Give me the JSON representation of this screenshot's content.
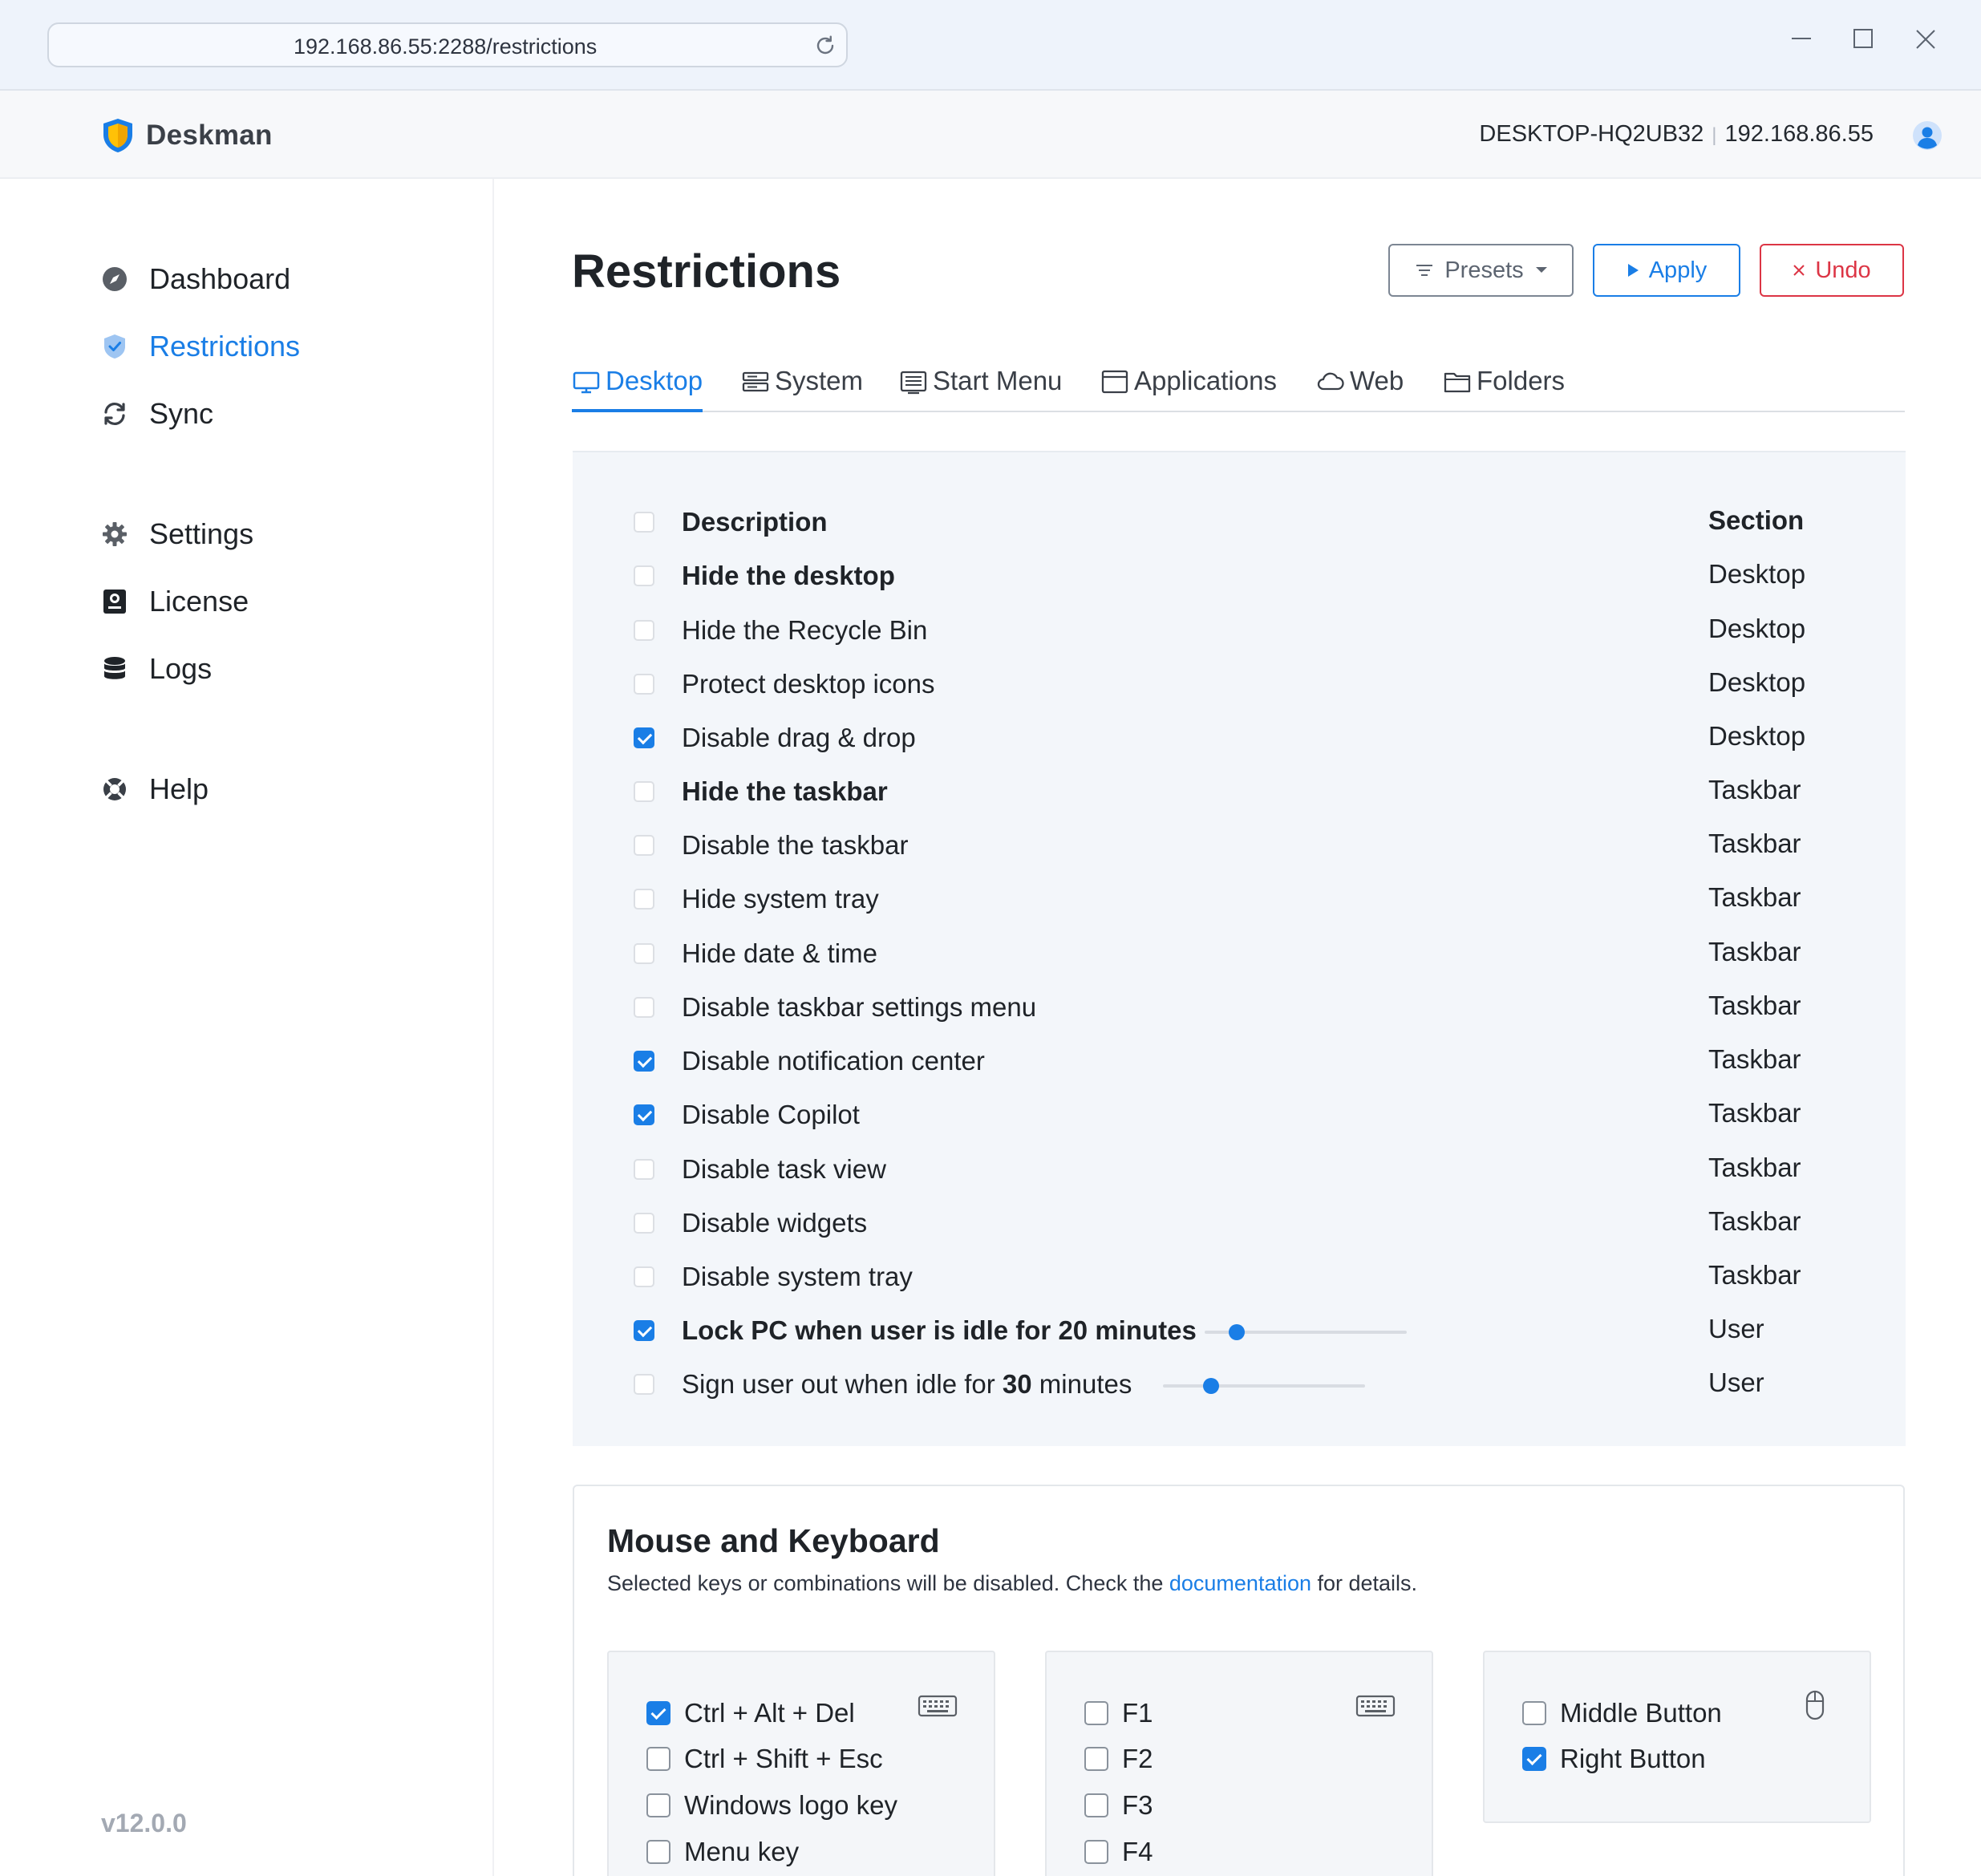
{
  "window": {
    "url": "192.168.86.55:2288/restrictions"
  },
  "header": {
    "brand": "Deskman",
    "machine_name": "DESKTOP-HQ2UB32",
    "ip": "192.168.86.55"
  },
  "sidebar": {
    "items": [
      {
        "label": "Dashboard",
        "icon": "compass-icon"
      },
      {
        "label": "Restrictions",
        "icon": "shield-check-icon",
        "active": true
      },
      {
        "label": "Sync",
        "icon": "sync-icon"
      },
      {
        "label": "Settings",
        "icon": "gear-icon"
      },
      {
        "label": "License",
        "icon": "license-icon"
      },
      {
        "label": "Logs",
        "icon": "database-icon"
      },
      {
        "label": "Help",
        "icon": "lifebuoy-icon"
      }
    ],
    "version": "v12.0.0"
  },
  "main": {
    "title": "Restrictions",
    "buttons": {
      "presets": "Presets",
      "apply": "Apply",
      "undo": "Undo"
    },
    "tabs": [
      {
        "label": "Desktop",
        "icon": "monitor-icon",
        "active": true
      },
      {
        "label": "System",
        "icon": "server-icon"
      },
      {
        "label": "Start Menu",
        "icon": "menu-window-icon"
      },
      {
        "label": "Applications",
        "icon": "app-window-icon"
      },
      {
        "label": "Web",
        "icon": "cloud-icon"
      },
      {
        "label": "Folders",
        "icon": "folder-icon"
      }
    ],
    "table": {
      "headers": {
        "description": "Description",
        "section": "Section"
      },
      "rows": [
        {
          "description": "Hide the desktop",
          "section": "Desktop",
          "checked": false,
          "bold": true
        },
        {
          "description": "Hide the Recycle Bin",
          "section": "Desktop",
          "checked": false
        },
        {
          "description": "Protect desktop icons",
          "section": "Desktop",
          "checked": false
        },
        {
          "description": "Disable drag & drop",
          "section": "Desktop",
          "checked": true
        },
        {
          "description": "Hide the taskbar",
          "section": "Taskbar",
          "checked": false,
          "bold": true
        },
        {
          "description": "Disable the taskbar",
          "section": "Taskbar",
          "checked": false
        },
        {
          "description": "Hide system tray",
          "section": "Taskbar",
          "checked": false
        },
        {
          "description": "Hide date & time",
          "section": "Taskbar",
          "checked": false
        },
        {
          "description": "Disable taskbar settings menu",
          "section": "Taskbar",
          "checked": false
        },
        {
          "description": "Disable notification center",
          "section": "Taskbar",
          "checked": true
        },
        {
          "description": "Disable Copilot",
          "section": "Taskbar",
          "checked": true
        },
        {
          "description": "Disable task view",
          "section": "Taskbar",
          "checked": false
        },
        {
          "description": "Disable widgets",
          "section": "Taskbar",
          "checked": false
        },
        {
          "description": "Disable system tray",
          "section": "Taskbar",
          "checked": false
        },
        {
          "description_pre": "Lock PC when user is idle for ",
          "minutes": "20",
          "description_post": " minutes",
          "section": "User",
          "checked": true,
          "bold": true,
          "slider_level": 0.16
        },
        {
          "description_pre": "Sign user out when idle for ",
          "minutes": "30",
          "description_post": " minutes",
          "section": "User",
          "checked": false,
          "slider_level": 0.24
        }
      ]
    },
    "mouse_keyboard": {
      "title": "Mouse and Keyboard",
      "desc_pre": "Selected keys or combinations will be disabled. Check the ",
      "desc_link": "documentation",
      "desc_post": " for details.",
      "groups": [
        {
          "icon": "keyboard-icon",
          "items": [
            {
              "label": "Ctrl + Alt + Del",
              "checked": true
            },
            {
              "label": "Ctrl + Shift + Esc",
              "checked": false
            },
            {
              "label": "Windows logo key",
              "checked": false
            },
            {
              "label": "Menu key",
              "checked": false
            }
          ]
        },
        {
          "icon": "keyboard-icon",
          "items": [
            {
              "label": "F1",
              "checked": false
            },
            {
              "label": "F2",
              "checked": false
            },
            {
              "label": "F3",
              "checked": false
            },
            {
              "label": "F4",
              "checked": false
            }
          ]
        },
        {
          "icon": "mouse-icon",
          "items": [
            {
              "label": "Middle Button",
              "checked": false
            },
            {
              "label": "Right Button",
              "checked": true
            }
          ]
        }
      ]
    }
  },
  "colors": {
    "accent": "#1a7ee6",
    "danger": "#dc3545",
    "panel_bg": "#f3f6fa"
  }
}
